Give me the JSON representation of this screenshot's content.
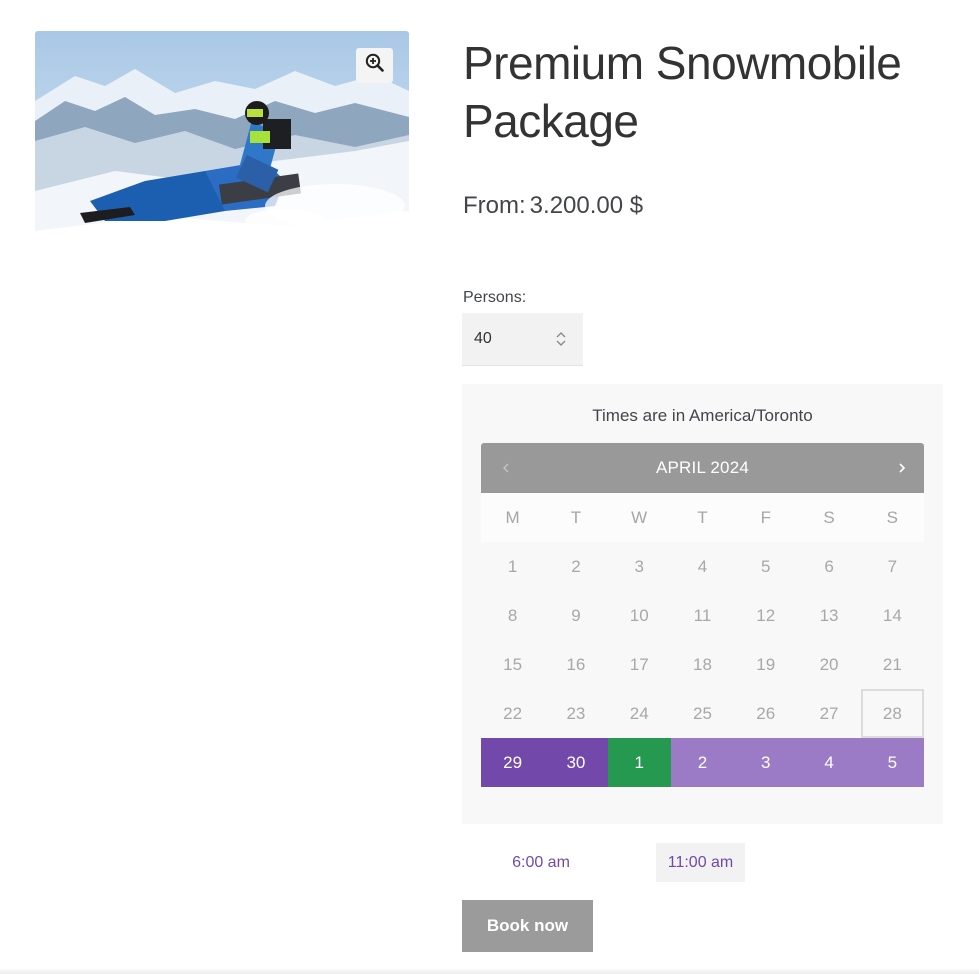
{
  "product": {
    "title": "Premium Snowmobile Package",
    "price_prefix": "From:",
    "price": "3.200.00 $",
    "image_alt": "Snowmobile rider in mountains"
  },
  "persons": {
    "label": "Persons:",
    "value": "40"
  },
  "calendar": {
    "timezone_note": "Times are in America/Toronto",
    "month": "APRIL 2024",
    "weekdays": [
      "M",
      "T",
      "W",
      "T",
      "F",
      "S",
      "S"
    ],
    "weeks": [
      [
        "1",
        "2",
        "3",
        "4",
        "5",
        "6",
        "7"
      ],
      [
        "8",
        "9",
        "10",
        "11",
        "12",
        "13",
        "14"
      ],
      [
        "15",
        "16",
        "17",
        "18",
        "19",
        "20",
        "21"
      ],
      [
        "22",
        "23",
        "24",
        "25",
        "26",
        "27",
        "28"
      ],
      [
        "29",
        "30",
        "1",
        "2",
        "3",
        "4",
        "5"
      ]
    ]
  },
  "times": [
    "6:00 am",
    "11:00 am"
  ],
  "book_button": "Book now",
  "colors": {
    "selected": "#7249aa",
    "today": "#24994f",
    "available": "#9b7bc5",
    "header": "#999999"
  },
  "icons": {
    "zoom": "zoom-in-icon",
    "prev": "chevron-left-icon",
    "next": "chevron-right-icon",
    "stepper": "up-down-stepper-icon"
  }
}
